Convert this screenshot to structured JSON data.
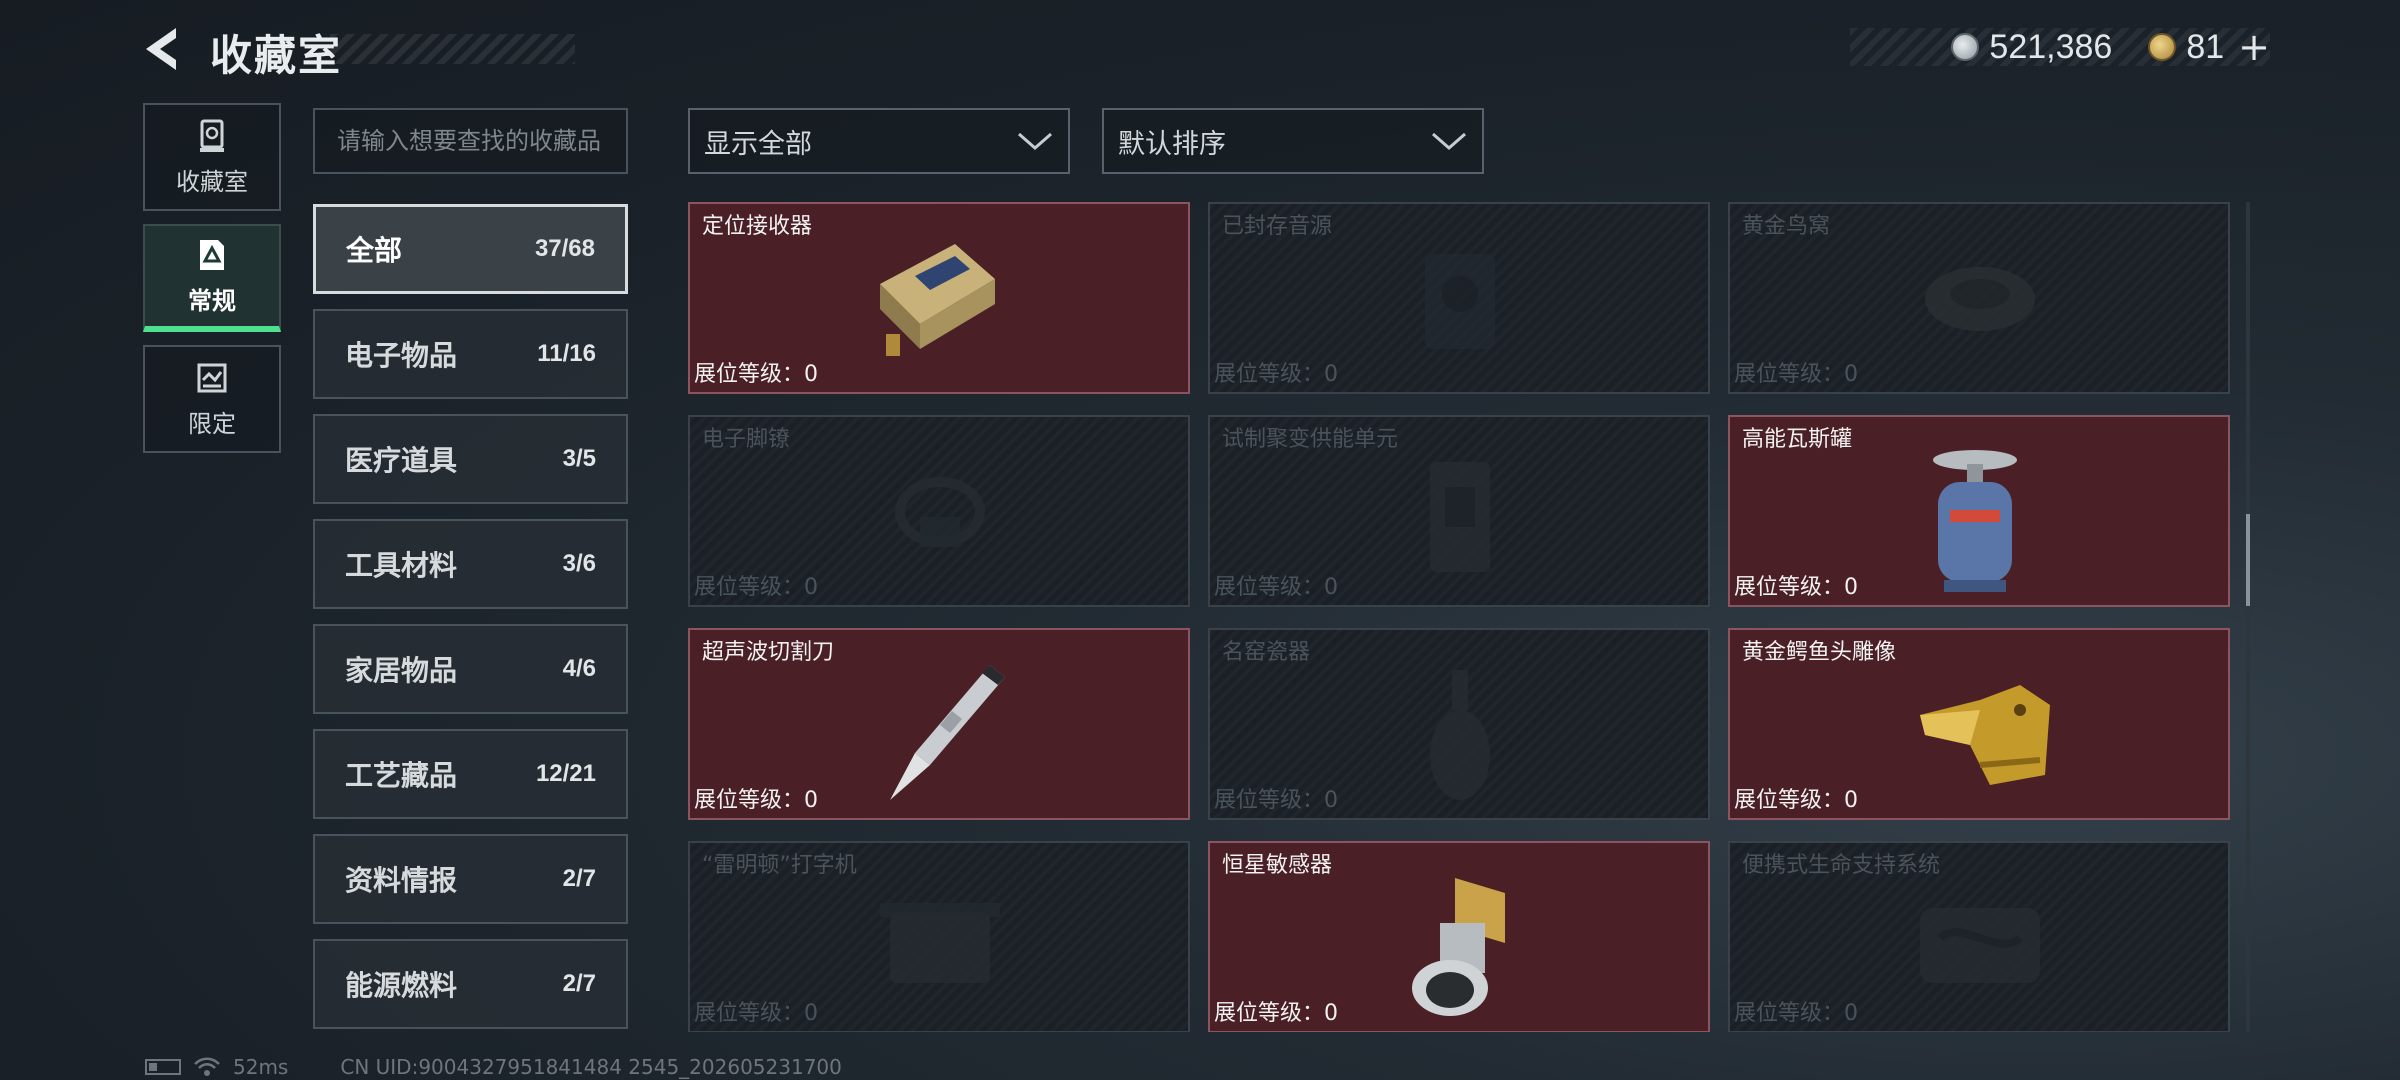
{
  "header": {
    "title": "收藏室",
    "currency_silver": "521,386",
    "currency_gold": "81",
    "plus": "+"
  },
  "sidenav": [
    {
      "label": "收藏室",
      "icon": "collection-room-icon"
    },
    {
      "label": "常规",
      "icon": "regular-icon",
      "active": true
    },
    {
      "label": "限定",
      "icon": "limited-icon"
    }
  ],
  "search": {
    "placeholder": "请输入想要查找的收藏品"
  },
  "categories": [
    {
      "name": "全部",
      "count": "37/68",
      "active": true
    },
    {
      "name": "电子物品",
      "count": "11/16"
    },
    {
      "name": "医疗道具",
      "count": "3/5"
    },
    {
      "name": "工具材料",
      "count": "3/6"
    },
    {
      "name": "家居物品",
      "count": "4/6"
    },
    {
      "name": "工艺藏品",
      "count": "12/21"
    },
    {
      "name": "资料情报",
      "count": "2/7"
    },
    {
      "name": "能源燃料",
      "count": "2/7"
    }
  ],
  "filters": {
    "display": "显示全部",
    "sort": "默认排序"
  },
  "items": [
    {
      "name": "定位接收器",
      "level": "展位等级：0",
      "owned": true,
      "icon": "receiver-icon"
    },
    {
      "name": "已封存音源",
      "level": "展位等级：0",
      "owned": false,
      "icon": "sealed-audio-icon"
    },
    {
      "name": "黄金鸟窝",
      "level": "展位等级：0",
      "owned": false,
      "icon": "golden-nest-icon"
    },
    {
      "name": "电子脚镣",
      "level": "展位等级：0",
      "owned": false,
      "icon": "ankle-monitor-icon"
    },
    {
      "name": "试制聚变供能单元",
      "level": "展位等级：0",
      "owned": false,
      "icon": "fusion-unit-icon"
    },
    {
      "name": "高能瓦斯罐",
      "level": "展位等级：0",
      "owned": true,
      "icon": "gas-tank-icon"
    },
    {
      "name": "超声波切割刀",
      "level": "展位等级：0",
      "owned": true,
      "icon": "ultrasonic-knife-icon"
    },
    {
      "name": "名窑瓷器",
      "level": "展位等级：0",
      "owned": false,
      "icon": "porcelain-vase-icon"
    },
    {
      "name": "黄金鳄鱼头雕像",
      "level": "展位等级：0",
      "owned": true,
      "icon": "gold-crocodile-icon"
    },
    {
      "name": "“雷明顿”打字机",
      "level": "展位等级：0",
      "owned": false,
      "icon": "typewriter-icon"
    },
    {
      "name": "恒星敏感器",
      "level": "展位等级：0",
      "owned": true,
      "icon": "star-sensor-icon"
    },
    {
      "name": "便携式生命支持系统",
      "level": "展位等级：0",
      "owned": false,
      "icon": "life-support-icon"
    }
  ],
  "footer": {
    "ping": "52ms",
    "uid": "CN UID:9004327951841484 2545_202605231700"
  }
}
